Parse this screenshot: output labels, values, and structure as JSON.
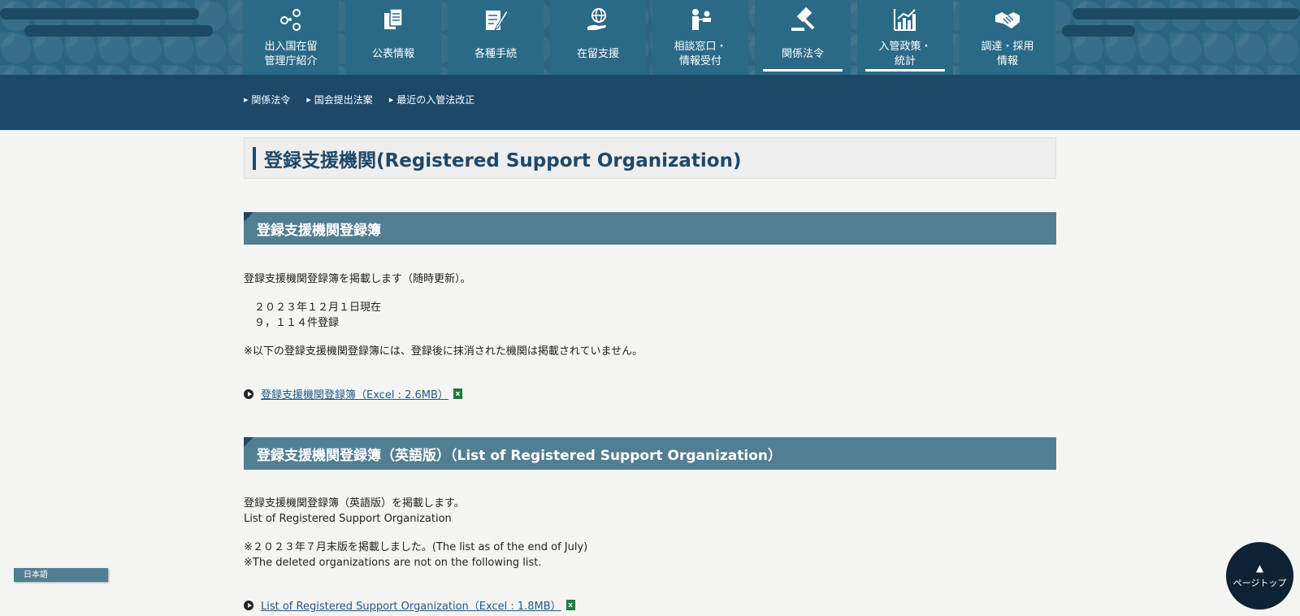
{
  "nav": {
    "items": [
      {
        "label": "出入国在留\n管理庁紹介",
        "icon": "people-network-icon"
      },
      {
        "label": "公表情報",
        "icon": "documents-icon"
      },
      {
        "label": "各種手続",
        "icon": "form-pen-icon"
      },
      {
        "label": "在留支援",
        "icon": "globe-hand-icon"
      },
      {
        "label": "相談窓口・\n情報受付",
        "icon": "consultation-icon"
      },
      {
        "label": "関係法令",
        "icon": "gavel-icon"
      },
      {
        "label": "入管政策・\n統計",
        "icon": "bar-chart-icon"
      },
      {
        "label": "調達・採用\n情報",
        "icon": "handshake-icon"
      }
    ],
    "active_index": 5
  },
  "subnav": {
    "links": [
      "関係法令",
      "国会提出法案",
      "最近の入管法改正"
    ]
  },
  "page": {
    "title": "登録支援機関(Registered Support Organization)"
  },
  "section1": {
    "heading": "登録支援機関登録簿",
    "intro": "登録支援機関登録簿を掲載します（随時更新）。",
    "date_line": "　２０２３年１２月１日現在",
    "count_line": "　９，１１４件登録",
    "note": "※以下の登録支援機関登録簿には、登録後に抹消された機関は掲載されていません。",
    "link_label": "登録支援機関登録簿（Excel : 2.6MB）"
  },
  "section2": {
    "heading": "登録支援機関登録簿（英語版）（List of Registered Support Organization）",
    "intro_jp": "登録支援機関登録簿（英語版）を掲載します。",
    "intro_en": "List of Registered Support Organization",
    "note1": "※２０２３年７月末版を掲載しました。(The list as of the end of July)",
    "note2": "※The deleted organizations are not on the following list.",
    "link_label": "List of Registered Support Organization（Excel : 1.8MB）"
  },
  "lang_button": "日本語",
  "page_top": {
    "label": "ページトップ",
    "icon": "arrow-up-bar-icon"
  },
  "colors": {
    "nav_bg": "#2b6a87",
    "subnav_bg": "#1e4868",
    "section_head_bg": "#527e91",
    "link": "#1e5a8a",
    "excel_green": "#1f7a3d"
  }
}
